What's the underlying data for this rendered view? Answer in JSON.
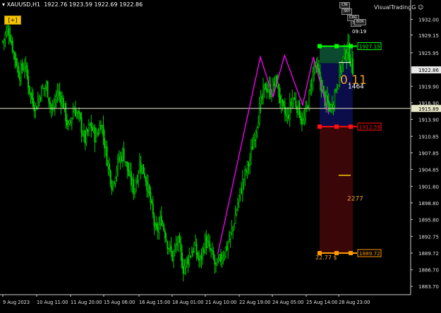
{
  "header": {
    "symbol": "XAUUSD,H1",
    "ohlc": "1922.76 1923.59 1922.69 1922.86",
    "plus_label": "[+]",
    "brand": "VisualTradingG"
  },
  "panel": {
    "buttons": [
      "CNI",
      "SKY",
      "CAG",
      "SYS",
      "BOR"
    ],
    "timer": "09:19"
  },
  "colors": {
    "background": "#000000",
    "candles": "#00c800",
    "pattern": "#ff00ff",
    "tp_zone": "#0b4a2e",
    "entry_zone": "#0a0d4a",
    "sl_zone": "#3a0608",
    "tp_line": "#00ff00",
    "entry_line": "#ff1010",
    "sl_line": "#ff9900",
    "crosshair": "#e6e6c8"
  },
  "chart_data": {
    "type": "candlestick",
    "symbol": "XAUUSD",
    "timeframe": "H1",
    "ylim": [
      1882.2,
      1935.5
    ],
    "yticks": [
      "1932.00",
      "1929.15",
      "1925.95",
      "1922.86",
      "1919.90",
      "1916.90",
      "1913.90",
      "1910.85",
      "1907.85",
      "1904.85",
      "1901.80",
      "1898.80",
      "1895.80",
      "1892.75",
      "1889.72",
      "1886.70",
      "1883.70"
    ],
    "xticks": [
      "9 Aug 2023",
      "10 Aug 11:00",
      "11 Aug 20:00",
      "15 Aug 06:00",
      "16 Aug 15:00",
      "18 Aug 01:00",
      "21 Aug 10:00",
      "22 Aug 19:00",
      "24 Aug 05:00",
      "25 Aug 14:00",
      "28 Aug 23:00"
    ],
    "close_path": [
      1928,
      1930.5,
      1926,
      1922,
      1924,
      1918.5,
      1916,
      1919,
      1920,
      1915,
      1919,
      1917,
      1912,
      1916,
      1914,
      1910,
      1913,
      1910.5,
      1913.5,
      1907,
      1902,
      1906,
      1908,
      1904,
      1901,
      1906,
      1904,
      1899,
      1893,
      1896,
      1892,
      1889,
      1892,
      1887,
      1889,
      1891,
      1888,
      1892,
      1890,
      1887,
      1889,
      1891,
      1894,
      1899,
      1903,
      1906,
      1911,
      1916,
      1920,
      1919,
      1921,
      1916,
      1914,
      1918,
      1916,
      1913,
      1918,
      1924,
      1921,
      1917,
      1916,
      1920,
      1924,
      1927,
      1922.86
    ],
    "pattern": {
      "label": "0.11",
      "x": [
        0.53,
        0.634,
        0.665,
        0.693,
        0.737,
        0.763,
        0.8
      ],
      "y": [
        1889.5,
        1925.2,
        1918.0,
        1925.5,
        1916.5,
        1925.2,
        1915.0
      ]
    },
    "current_price": "1922.86",
    "crosshair_price": "1915.89",
    "levels": {
      "take_profit": "1927.15",
      "entry": "1912.59",
      "stop_loss": "1889.72",
      "upper_mark": "1924.2",
      "mid_mark": "1903.8"
    },
    "labels": {
      "entry_points": "1464",
      "sl_points": "2277",
      "sl_money": "22.77 $"
    }
  }
}
